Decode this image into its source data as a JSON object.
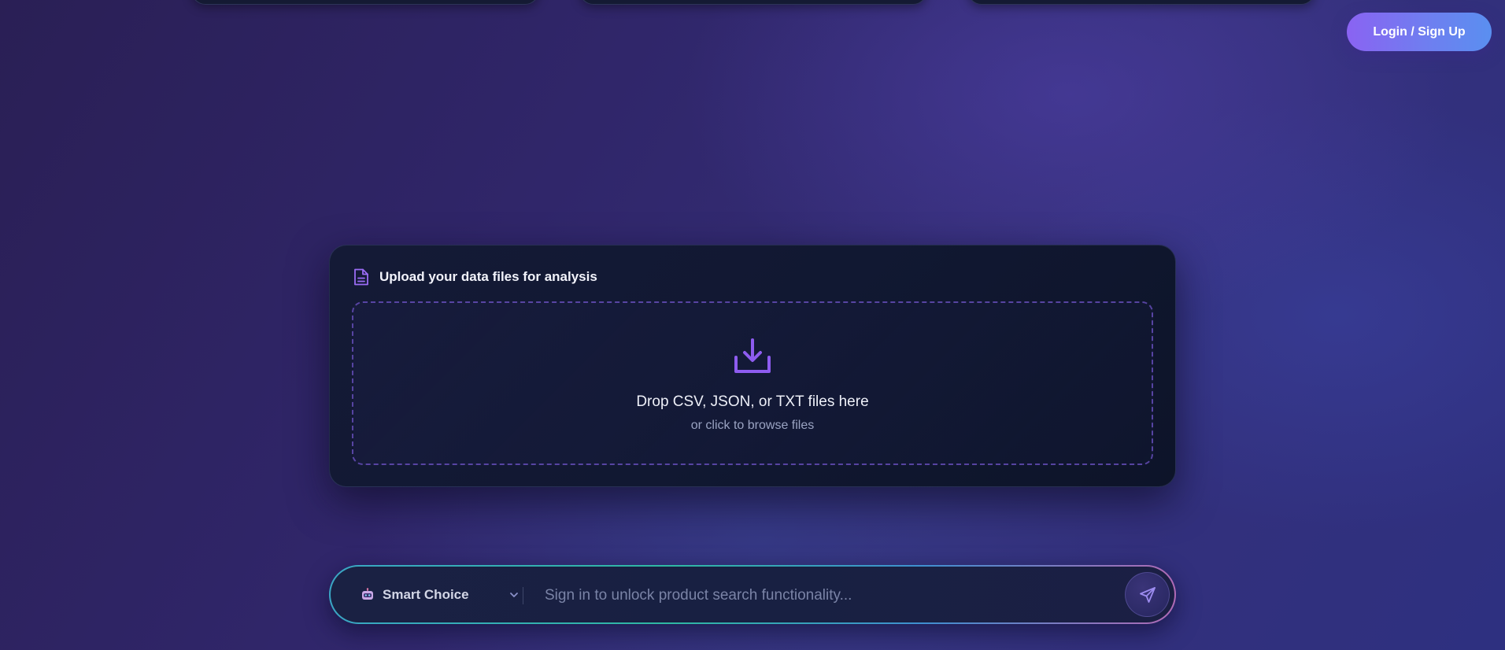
{
  "header": {
    "login_label": "Login / Sign Up"
  },
  "upload": {
    "title": "Upload your data files for analysis",
    "drop_text": "Drop CSV, JSON, or TXT files here",
    "browse_text": "or click to browse files",
    "icon": "document-icon",
    "drop_icon": "download-icon"
  },
  "search": {
    "model_label": "Smart Choice",
    "model_icon": "robot-icon",
    "placeholder": "Sign in to unlock product search functionality...",
    "send_icon": "send-icon"
  },
  "colors": {
    "accent": "#8a63f2",
    "login_gradient_start": "#8a63f2",
    "login_gradient_end": "#5a8ff0"
  }
}
